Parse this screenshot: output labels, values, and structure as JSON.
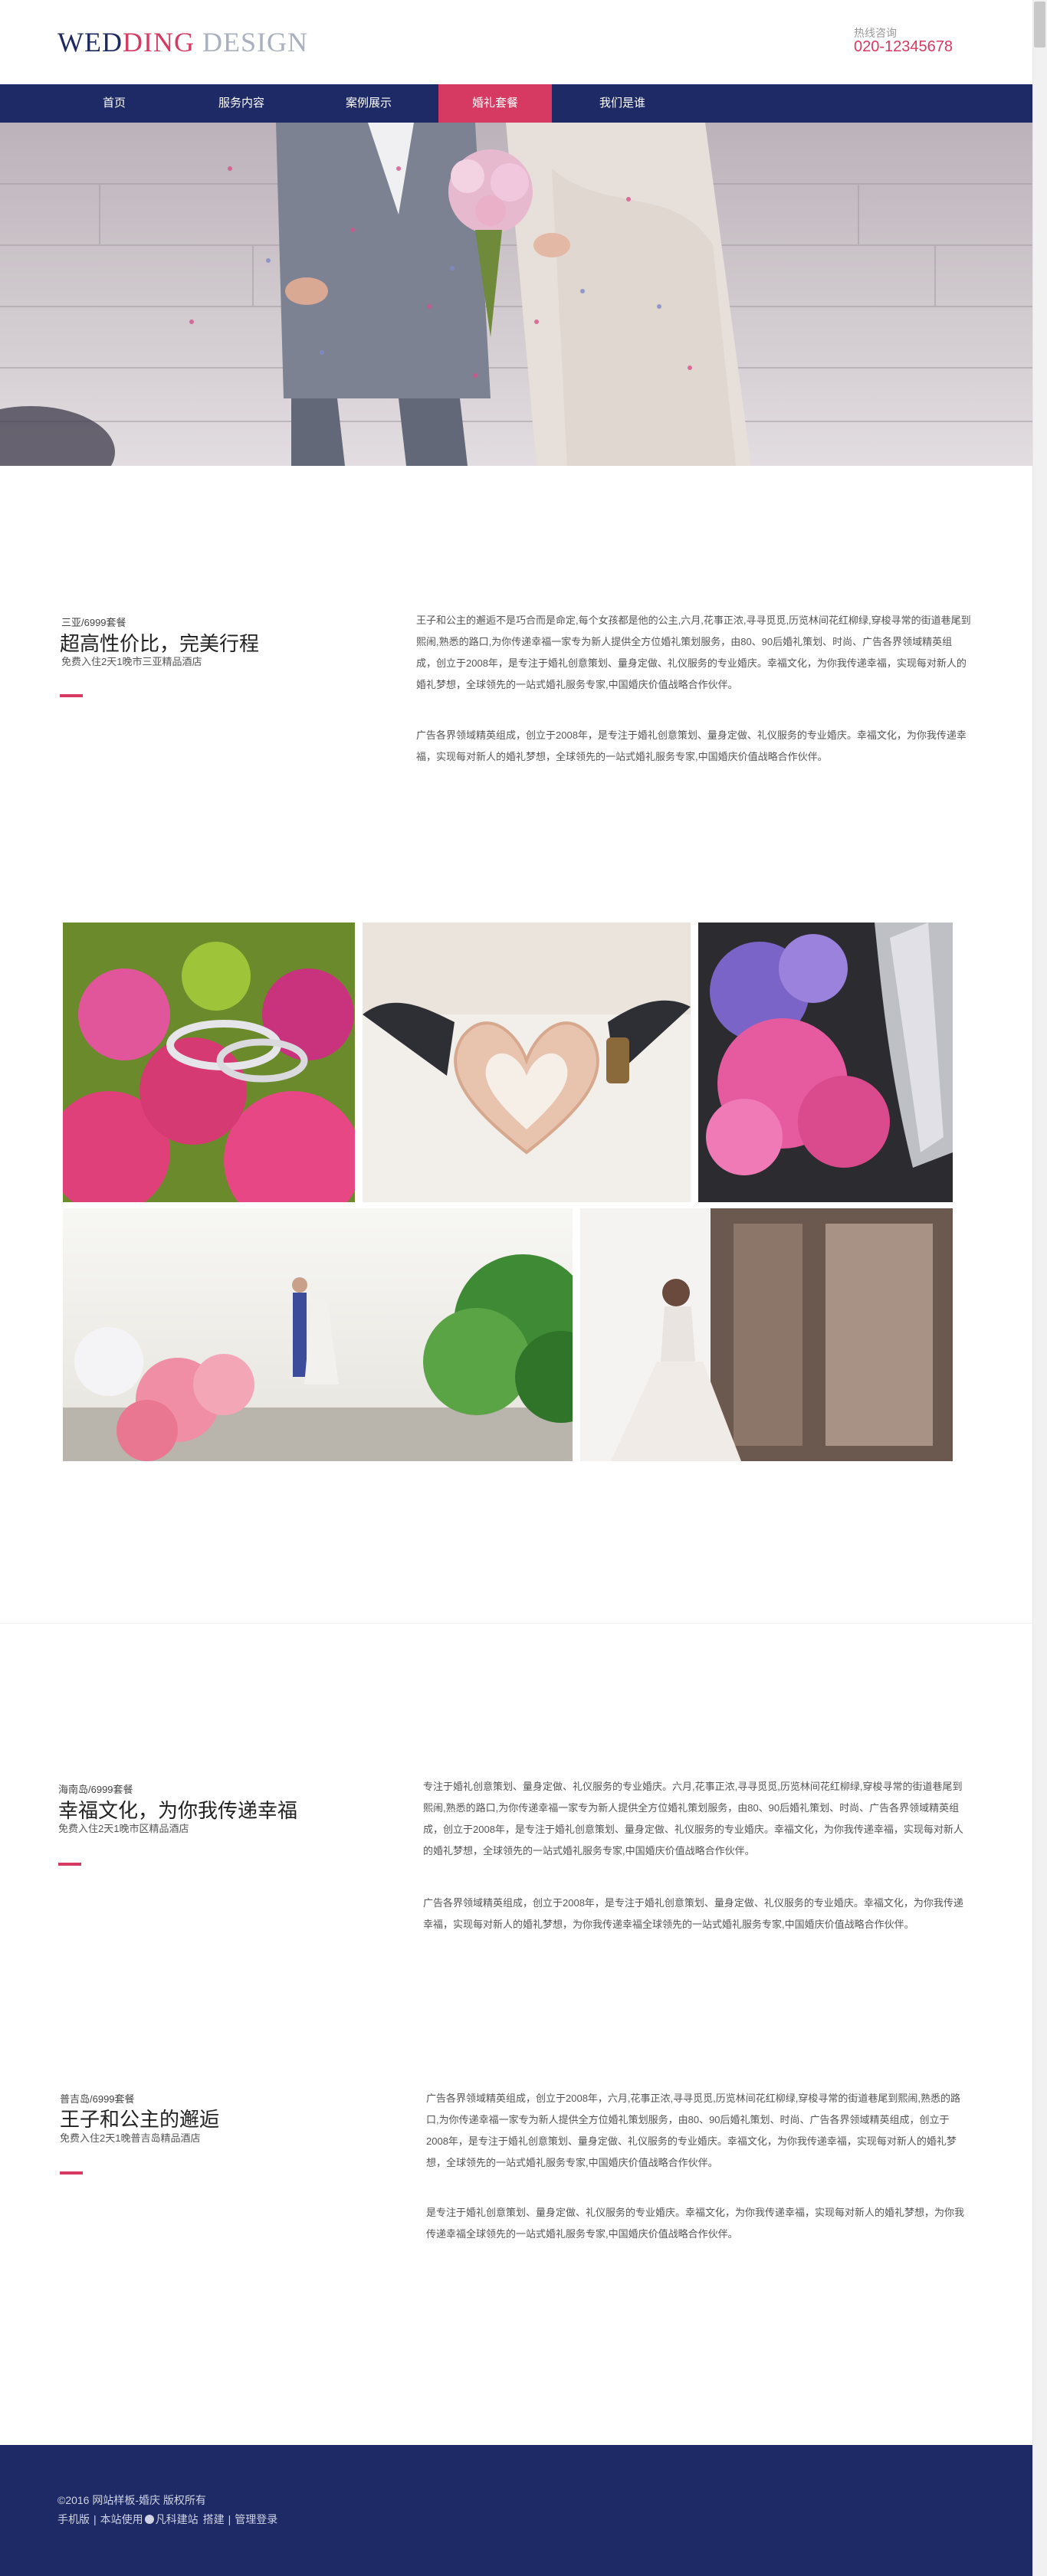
{
  "header": {
    "logo_part1": "WED",
    "logo_part2": "DING",
    "logo_part3": " DESIGN",
    "hotline_label": "热线咨询",
    "hotline_phone": "020-12345678"
  },
  "nav": {
    "items": [
      {
        "label": "首页"
      },
      {
        "label": "服务内容"
      },
      {
        "label": "案例展示"
      },
      {
        "label": "婚礼套餐"
      },
      {
        "label": "我们是谁"
      }
    ],
    "active_index": 3
  },
  "section1": {
    "sub": "三亚/6999套餐",
    "title": "超高性价比，完美行程",
    "note": "免费入住2天1晚市三亚精品酒店",
    "para1": "王子和公主的邂逅不是巧合而是命定,每个女孩都是他的公主,六月,花事正浓,寻寻觅觅,历览林间花红柳绿,穿梭寻常的街道巷尾到熙闹,熟悉的路口,为你传递幸福一家专为新人提供全方位婚礼策划服务，由80、90后婚礼策划、时尚、广告各界领域精英组成，创立于2008年，是专注于婚礼创意策划、量身定做、礼仪服务的专业婚庆。幸福文化，为你我传递幸福，实现每对新人的婚礼梦想，全球领先的一站式婚礼服务专家,中国婚庆价值战略合作伙伴。",
    "para2": "广告各界领域精英组成，创立于2008年，是专注于婚礼创意策划、量身定做、礼仪服务的专业婚庆。幸福文化，为你我传递幸福，实现每对新人的婚礼梦想，全球领先的一站式婚礼服务专家,中国婚庆价值战略合作伙伴。"
  },
  "section2": {
    "sub": "海南岛/6999套餐",
    "title": "幸福文化，为你我传递幸福",
    "note": "免费入住2天1晚市区精品酒店",
    "para1": "专注于婚礼创意策划、量身定做、礼仪服务的专业婚庆。六月,花事正浓,寻寻觅觅,历览林间花红柳绿,穿梭寻常的街道巷尾到熙闹,熟悉的路口,为你传递幸福一家专为新人提供全方位婚礼策划服务，由80、90后婚礼策划、时尚、广告各界领域精英组成，创立于2008年，是专注于婚礼创意策划、量身定做、礼仪服务的专业婚庆。幸福文化，为你我传递幸福，实现每对新人的婚礼梦想，全球领先的一站式婚礼服务专家,中国婚庆价值战略合作伙伴。",
    "para2": "广告各界领域精英组成，创立于2008年，是专注于婚礼创意策划、量身定做、礼仪服务的专业婚庆。幸福文化，为你我传递幸福，实现每对新人的婚礼梦想，为你我传递幸福全球领先的一站式婚礼服务专家,中国婚庆价值战略合作伙伴。"
  },
  "section3": {
    "sub": "普吉岛/6999套餐",
    "title": "王子和公主的邂逅",
    "note": "免费入住2天1晚普吉岛精品酒店",
    "para1": "广告各界领域精英组成，创立于2008年，六月,花事正浓,寻寻觅觅,历览林间花红柳绿,穿梭寻常的街道巷尾到熙闹,熟悉的路口,为你传递幸福一家专为新人提供全方位婚礼策划服务，由80、90后婚礼策划、时尚、广告各界领域精英组成，创立于2008年，是专注于婚礼创意策划、量身定做、礼仪服务的专业婚庆。幸福文化，为你我传递幸福，实现每对新人的婚礼梦想，全球领先的一站式婚礼服务专家,中国婚庆价值战略合作伙伴。",
    "para2": "是专注于婚礼创意策划、量身定做、礼仪服务的专业婚庆。幸福文化，为你我传递幸福，实现每对新人的婚礼梦想，为你我传递幸福全球领先的一站式婚礼服务专家,中国婚庆价值战略合作伙伴。"
  },
  "footer": {
    "copyright": "©2016 网站样板-婚庆 版权所有",
    "links": [
      "手机版",
      "本站使用",
      "凡科建站",
      "搭建",
      "管理登录"
    ]
  },
  "colors": {
    "brand_navy": "#1e2a66",
    "accent_pink": "#d63a62"
  }
}
